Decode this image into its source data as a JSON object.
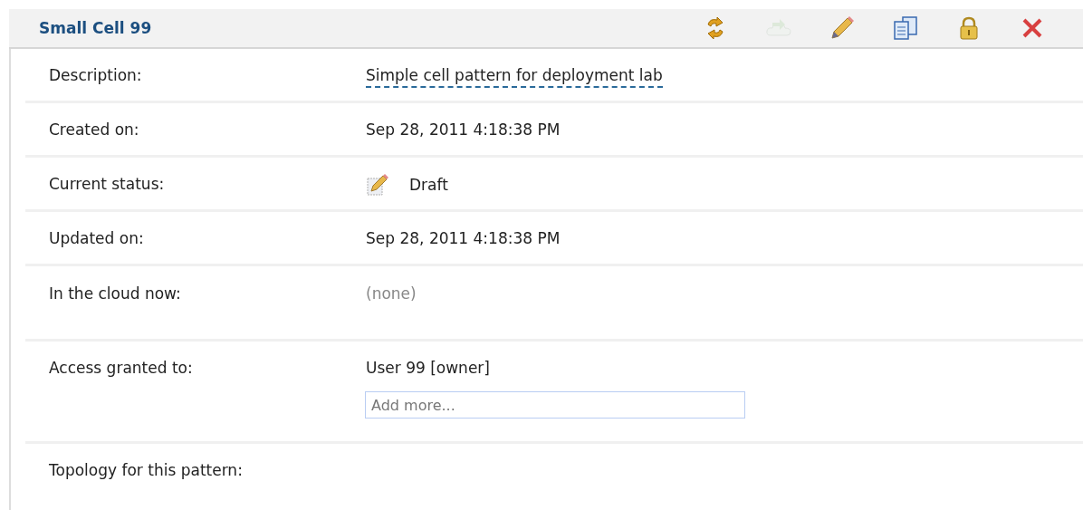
{
  "header": {
    "title": "Small Cell 99"
  },
  "toolbar": [
    {
      "kind": "refresh",
      "disabled": false
    },
    {
      "kind": "deploy",
      "disabled": true
    },
    {
      "kind": "edit",
      "disabled": false
    },
    {
      "kind": "copy",
      "disabled": false
    },
    {
      "kind": "lock",
      "disabled": false
    },
    {
      "kind": "delete",
      "disabled": false
    }
  ],
  "rows": [
    {
      "kind": "link",
      "label": "Description:",
      "value": "Simple cell pattern for deployment lab"
    },
    {
      "kind": "text",
      "label": "Created on:",
      "value": "Sep 28, 2011 4:18:38 PM"
    },
    {
      "kind": "status",
      "label": "Current status:",
      "value": "Draft"
    },
    {
      "kind": "text",
      "label": "Updated on:",
      "value": "Sep 28, 2011 4:18:38 PM"
    },
    {
      "kind": "muted",
      "label": "In the cloud now:",
      "value": "(none)"
    },
    {
      "kind": "access",
      "label": "Access granted to:",
      "value": "User 99 [owner]",
      "placeholder": "Add more..."
    },
    {
      "kind": "empty",
      "label": "Topology for this pattern:"
    }
  ]
}
